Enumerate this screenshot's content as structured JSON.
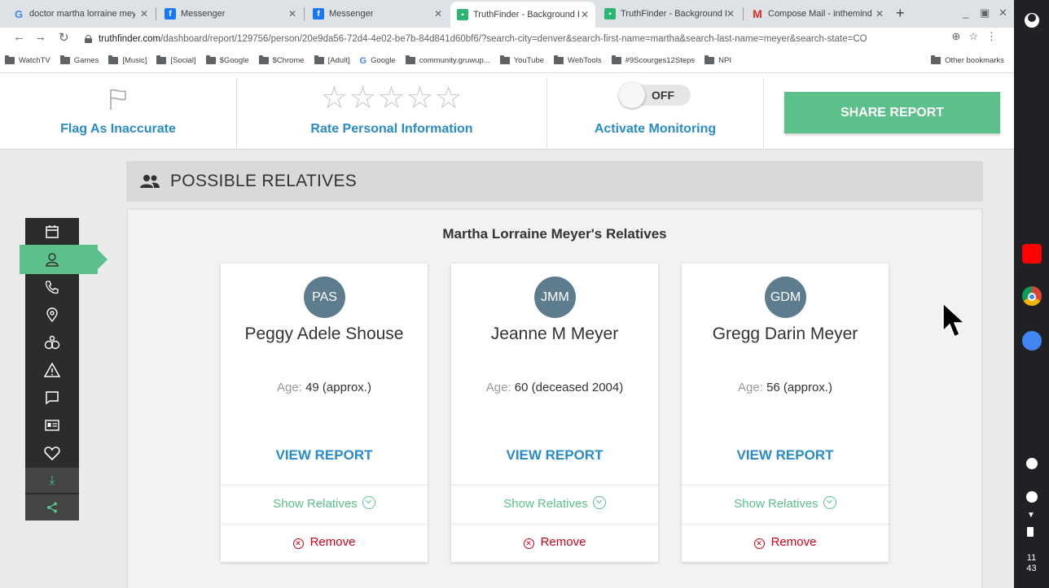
{
  "browser": {
    "tabs": [
      {
        "title": "doctor martha lorraine mey",
        "icon": "google-icon"
      },
      {
        "title": "Messenger",
        "icon": "facebook-icon"
      },
      {
        "title": "Messenger",
        "icon": "facebook-icon"
      },
      {
        "title": "TruthFinder - Background R",
        "icon": "truthfinder-icon"
      },
      {
        "title": "TruthFinder - Background R",
        "icon": "truthfinder-icon"
      },
      {
        "title": "Compose Mail - inthemind",
        "icon": "gmail-icon"
      }
    ],
    "url_host": "truthfinder.com",
    "url_path": "/dashboard/report/129756/person/20e9da56-72d4-4e02-be7b-84d841d60bf6/?search-city=denver&search-first-name=martha&search-last-name=meyer&search-state=CO",
    "bookmarks": [
      "WatchTV",
      "Games",
      "[Music]",
      "[Social]",
      "$Google",
      "$Chrome",
      "[Adult]",
      "Google",
      "community.gruwup...",
      "YouTube",
      "WebTools",
      "#9Scourges12Steps",
      "NPI"
    ],
    "other_bookmarks": "Other bookmarks"
  },
  "actions": {
    "flag_label": "Flag As Inaccurate",
    "stars": "☆☆☆☆☆",
    "rate_label": "Rate Personal Information",
    "toggle_state": "OFF",
    "monitor_label": "Activate Monitoring",
    "share_label": "SHARE REPORT"
  },
  "section": {
    "title": "POSSIBLE RELATIVES",
    "subtitle": "Martha Lorraine Meyer's Relatives"
  },
  "relatives": [
    {
      "initials": "PAS",
      "name": "Peggy Adele Shouse",
      "age_label": "Age:",
      "age_value": "49 (approx.)",
      "view": "VIEW REPORT",
      "show": "Show Relatives",
      "remove": "Remove"
    },
    {
      "initials": "JMM",
      "name": "Jeanne M Meyer",
      "age_label": "Age:",
      "age_value": "60 (deceased 2004)",
      "view": "VIEW REPORT",
      "show": "Show Relatives",
      "remove": "Remove"
    },
    {
      "initials": "GDM",
      "name": "Gregg Darin Meyer",
      "age_label": "Age:",
      "age_value": "56 (approx.)",
      "view": "VIEW REPORT",
      "show": "Show Relatives",
      "remove": "Remove"
    }
  ],
  "shelf": {
    "time_hour": "11",
    "time_min": "43"
  },
  "colors": {
    "accent_green": "#5cc08a",
    "link_blue": "#2a8bc9",
    "remove_red": "#d0021b",
    "avatar": "#5d7d8e"
  }
}
